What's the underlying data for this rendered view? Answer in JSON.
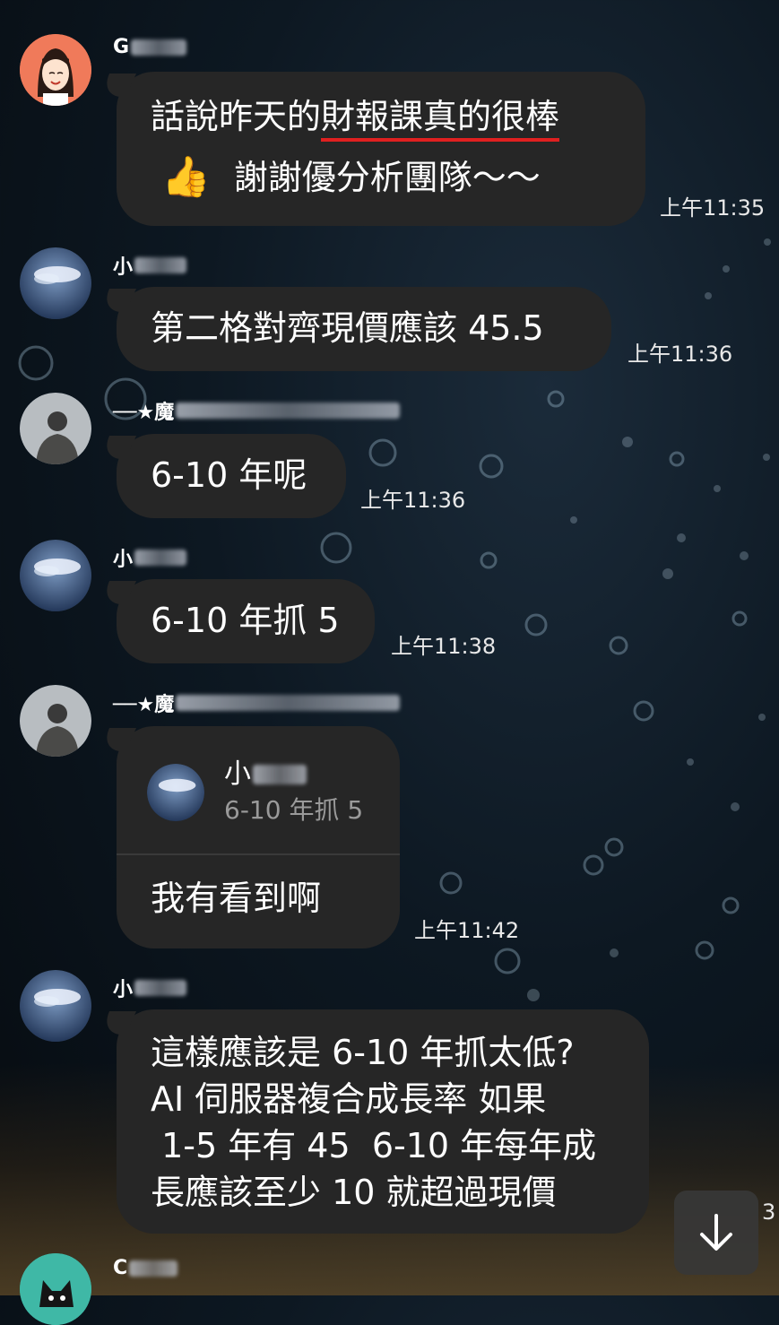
{
  "messages": [
    {
      "sender": "G",
      "text_underlined": "話說昨天的財報課真的很棒",
      "emoji": "👍",
      "text_line2": "謝謝優分析團隊～～",
      "time": "上午11:35"
    },
    {
      "sender": "小",
      "text": "第二格對齊現價應該 45.5",
      "time": "上午11:36"
    },
    {
      "sender": "──★魔",
      "text": "6-10 年呢",
      "time": "上午11:36"
    },
    {
      "sender": "小",
      "text": "6-10 年抓 5",
      "time": "上午11:38"
    },
    {
      "sender": "──★魔",
      "quote_name": "小",
      "quote_text": "6-10 年抓 5",
      "text": "我有看到啊",
      "time": "上午11:42"
    },
    {
      "sender": "小",
      "lines": [
        "這樣應該是 6-10 年抓太低?",
        "AI 伺服器複合成長率 如果",
        " 1-5 年有 45  6-10 年每年成",
        "長應該至少 10 就超過現價"
      ],
      "time": "3"
    },
    {
      "sender": "C"
    }
  ],
  "scroll_button_icon": "arrow-down-icon",
  "colors": {
    "bubble": "#262626",
    "underline": "#e02020"
  }
}
